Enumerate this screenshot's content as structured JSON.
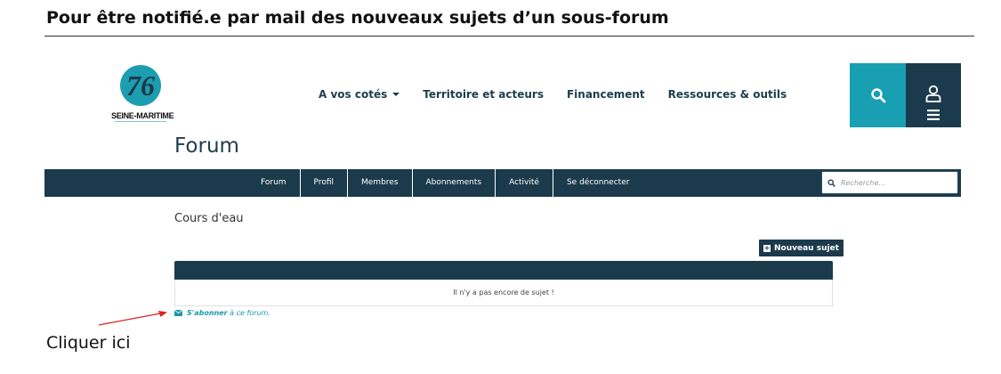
{
  "doc": {
    "title": "Pour être notifié.e par mail des nouveaux sujets d’un sous-forum",
    "instruction": "Cliquer ici"
  },
  "site": {
    "logo_number": "76",
    "logo_name": "SEINE-MARITIME",
    "top_nav": [
      {
        "label": "A vos cotés",
        "has_dropdown": true
      },
      {
        "label": "Territoire et acteurs"
      },
      {
        "label": "Financement"
      },
      {
        "label": "Ressources & outils"
      }
    ]
  },
  "forum": {
    "title": "Forum",
    "nav": [
      {
        "label": "Forum"
      },
      {
        "label": "Profil"
      },
      {
        "label": "Membres"
      },
      {
        "label": "Abonnements"
      },
      {
        "label": "Activité"
      },
      {
        "label": "Se déconnecter"
      }
    ],
    "search_placeholder": "Recherche...",
    "breadcrumb": "Cours d'eau",
    "new_topic_label": "Nouveau sujet",
    "empty_message": "Il n'y a pas encore de sujet !",
    "subscribe": {
      "action": "S'abonner",
      "rest": " à ce forum."
    }
  },
  "colors": {
    "dark_navy": "#1b3a4c",
    "teal": "#189fb2",
    "arrow_red": "#e02020"
  },
  "icons": {
    "search": "magnifier-icon",
    "user": "user-icon",
    "menu": "hamburger-icon",
    "plus": "plus-square-icon",
    "envelope": "envelope-icon"
  }
}
